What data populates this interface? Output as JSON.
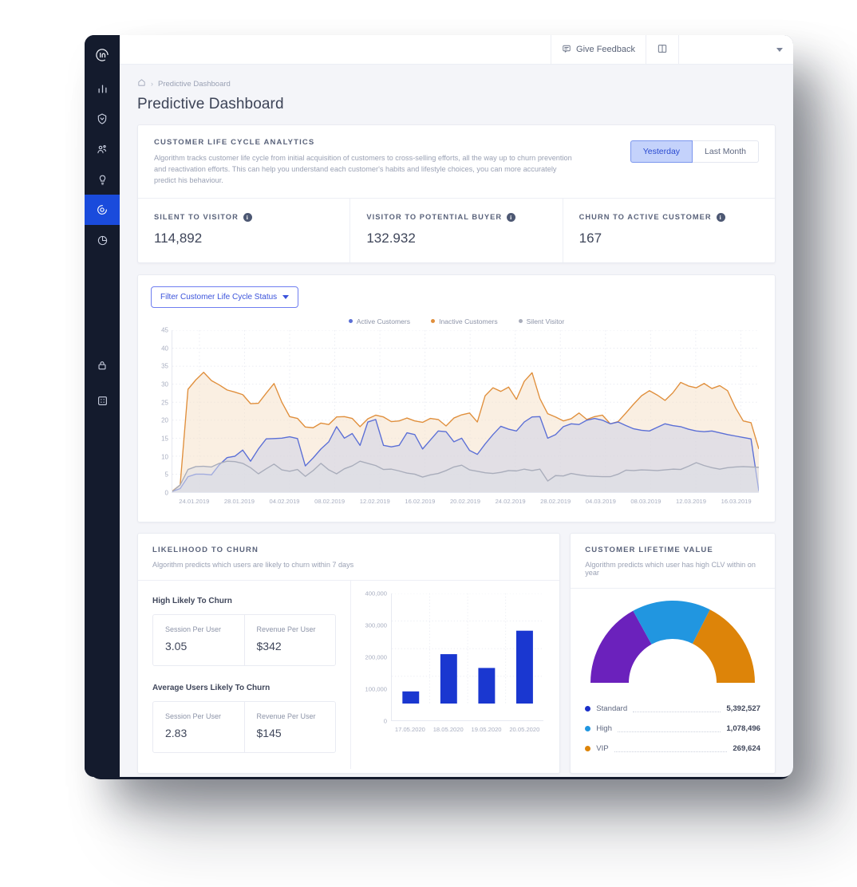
{
  "sidebar": {
    "logo_label": "in-logo-icon",
    "items": [
      {
        "name": "analytics",
        "icon": "bar-chart-icon",
        "active": false
      },
      {
        "name": "security",
        "icon": "shield-icon",
        "active": false
      },
      {
        "name": "audience",
        "icon": "users-icon",
        "active": false
      },
      {
        "name": "insights",
        "icon": "lightbulb-icon",
        "active": false
      },
      {
        "name": "predictive",
        "icon": "target-icon",
        "active": true
      },
      {
        "name": "reports",
        "icon": "pie-chart-icon",
        "active": false
      }
    ],
    "bottom_items": [
      {
        "name": "privacy",
        "icon": "lock-icon"
      },
      {
        "name": "apps",
        "icon": "grid-icon"
      }
    ]
  },
  "topbar": {
    "feedback_label": "Give Feedback",
    "feedback_icon": "comment-icon",
    "book_icon": "book-icon",
    "user_caret_icon": "chevron-down-icon"
  },
  "breadcrumb": {
    "home_icon": "home-icon",
    "separator": "›",
    "current": "Predictive Dashboard"
  },
  "page_title": "Predictive Dashboard",
  "analytics": {
    "kicker": "CUSTOMER LIFE CYCLE ANALYTICS",
    "description": "Algorithm tracks customer life cycle from initial acquisition of customers to cross-selling efforts, all the way up to churn prevention and reactivation efforts. This can help you understand each customer's habits and lifestyle choices, you can more accurately predict his behaviour.",
    "range_options": [
      {
        "label": "Yesterday",
        "active": true
      },
      {
        "label": "Last Month",
        "active": false
      }
    ],
    "kpis": [
      {
        "label": "SILENT TO VISITOR",
        "value": "114,892",
        "info_icon": "info-icon"
      },
      {
        "label": "VISITOR TO POTENTIAL BUYER",
        "value": "132.932",
        "info_icon": "info-icon"
      },
      {
        "label": "CHURN TO ACTIVE CUSTOMER",
        "value": "167",
        "info_icon": "info-icon"
      }
    ]
  },
  "lifecycle_chart": {
    "filter_label": "Filter Customer Life Cycle Status",
    "filter_caret_icon": "caret-down-icon"
  },
  "churn": {
    "kicker": "LIKELIHOOD TO CHURN",
    "description": "Algorithm predicts which users are likely to churn within 7 days",
    "groups": [
      {
        "title": "High Likely To Churn",
        "cells": [
          {
            "label": "Session Per User",
            "value": "3.05"
          },
          {
            "label": "Revenue Per User",
            "value": "$342"
          }
        ]
      },
      {
        "title": "Average Users Likely To Churn",
        "cells": [
          {
            "label": "Session Per User",
            "value": "2.83"
          },
          {
            "label": "Revenue Per User",
            "value": "$145"
          }
        ]
      }
    ]
  },
  "clv": {
    "kicker": "CUSTOMER LIFETIME VALUE",
    "description": "Algorithm predicts which user has high CLV within on year",
    "legend": [
      {
        "name": "Standard",
        "value": "5,392,527",
        "color": "#1a2fc9"
      },
      {
        "name": "High",
        "value": "1,078,496",
        "color": "#2196e0"
      },
      {
        "name": "VIP",
        "value": "269,624",
        "color": "#dd8409"
      }
    ]
  },
  "colors": {
    "accent_blue": "#1a4bdc",
    "sidebar_bg": "#141b2d",
    "active_customers": "#5b6fd6",
    "inactive_customers": "#e08f3c",
    "silent_visitor": "#a9adbb",
    "gauge_purple": "#6b21bc",
    "gauge_blue": "#2196e0",
    "gauge_orange": "#dd8409",
    "bar_blue": "#1a37d0"
  },
  "chart_data": [
    {
      "type": "area",
      "title": "",
      "xlabel": "",
      "ylabel": "",
      "ylim": [
        0,
        45
      ],
      "yticks": [
        0,
        5,
        10,
        15,
        20,
        25,
        30,
        35,
        40,
        45
      ],
      "grid": true,
      "legend_position": "top-center",
      "tick_labels": [
        "24.01.2019",
        "28.01.2019",
        "04.02.2019",
        "08.02.2019",
        "12.02.2019",
        "16.02.2019",
        "20.02.2019",
        "24.02.2019",
        "28.02.2019",
        "04.03.2019",
        "08.03.2019",
        "12.03.2019",
        "16.03.2019"
      ],
      "series": [
        {
          "name": "Inactive Customers",
          "color": "#e08f3c",
          "values": [
            0.3,
            2.0,
            28.6,
            31.2,
            33.3,
            31.0,
            29.8,
            28.4,
            27.8,
            27.1,
            24.6,
            24.7,
            27.5,
            30.2,
            25.0,
            21.0,
            20.5,
            18.1,
            17.9,
            19.2,
            18.8,
            20.9,
            21.0,
            20.5,
            18.2,
            20.4,
            21.4,
            20.9,
            19.6,
            19.8,
            20.6,
            19.8,
            19.4,
            20.5,
            20.2,
            18.4,
            20.6,
            21.5,
            22.0,
            19.5,
            26.8,
            29.0,
            28.0,
            29.2,
            25.8,
            30.8,
            33.2,
            26.0,
            21.8,
            20.9,
            19.8,
            20.4,
            22.0,
            20.2,
            21.0,
            21.4,
            19.0,
            19.6,
            22.0,
            24.5,
            26.8,
            28.2,
            27.0,
            25.5,
            27.6,
            30.5,
            29.5,
            29.0,
            30.2,
            28.8,
            29.6,
            28.2,
            23.5,
            19.8,
            19.3,
            12.0
          ]
        },
        {
          "name": "Active Customers",
          "color": "#5b6fd6",
          "values": [
            0.2,
            1.0,
            4.3,
            5.0,
            5.0,
            4.8,
            7.6,
            9.6,
            10.0,
            11.7,
            8.6,
            12.0,
            14.8,
            14.9,
            15.0,
            15.4,
            14.9,
            7.3,
            9.5,
            12.0,
            14.0,
            18.2,
            15.0,
            16.3,
            13.0,
            19.5,
            20.2,
            13.0,
            12.6,
            13.0,
            16.5,
            16.0,
            12.0,
            14.5,
            17.0,
            16.8,
            14.0,
            15.0,
            11.6,
            10.5,
            13.4,
            16.0,
            18.3,
            17.5,
            17.0,
            19.5,
            20.9,
            21.0,
            15.0,
            16.0,
            18.2,
            19.0,
            18.8,
            20.0,
            20.5,
            20.0,
            19.0,
            19.5,
            18.5,
            17.6,
            17.2,
            17.0,
            18.0,
            19.0,
            18.5,
            18.2,
            17.5,
            17.0,
            16.8,
            17.0,
            16.5,
            16.0,
            15.6,
            15.2,
            14.8,
            0.3
          ]
        },
        {
          "name": "Silent Visitor",
          "color": "#a9adbb",
          "values": [
            0.2,
            2.0,
            6.3,
            7.1,
            7.2,
            7.0,
            8.0,
            8.6,
            8.5,
            8.0,
            6.8,
            5.1,
            6.5,
            7.8,
            6.2,
            5.8,
            6.3,
            4.4,
            6.0,
            8.0,
            6.2,
            5.1,
            6.5,
            7.3,
            8.6,
            8.0,
            7.4,
            6.3,
            6.4,
            5.9,
            5.3,
            5.0,
            4.2,
            4.8,
            5.2,
            6.0,
            7.0,
            7.5,
            6.2,
            5.8,
            5.4,
            5.2,
            5.5,
            6.0,
            5.9,
            6.4,
            6.0,
            6.4,
            3.1,
            4.6,
            4.5,
            5.2,
            4.8,
            4.5,
            4.4,
            4.3,
            4.3,
            5.0,
            6.1,
            6.0,
            6.2,
            6.1,
            6.0,
            6.2,
            6.4,
            6.3,
            7.2,
            8.2,
            7.4,
            6.8,
            6.4,
            6.8,
            7.0,
            7.1,
            7.0,
            6.9
          ]
        }
      ]
    },
    {
      "type": "bar",
      "title": "",
      "categories": [
        "17.05.2020",
        "18.05.2020",
        "19.05.2020",
        "20.05.2020"
      ],
      "values": [
        45000,
        180000,
        130000,
        265000
      ],
      "ylim": [
        0,
        400000
      ],
      "yticks": [
        0,
        100000,
        200000,
        300000,
        400000
      ],
      "ytick_labels": [
        "0",
        "100,000",
        "200,000",
        "300,000",
        "400,000"
      ],
      "color": "#1a37d0",
      "grid": true
    },
    {
      "type": "pie",
      "subtype": "gauge-donut-half",
      "labels": [
        "Standard",
        "High",
        "VIP"
      ],
      "values": [
        5392527,
        1078496,
        269624
      ],
      "display_shares": [
        0.34,
        0.31,
        0.35
      ],
      "colors": [
        "#6b21bc",
        "#2196e0",
        "#dd8409"
      ]
    }
  ]
}
